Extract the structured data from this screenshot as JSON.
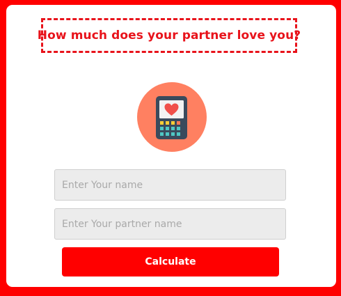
{
  "title": "How much does your partner love you?",
  "logo": {
    "icon": "calculator-heart-icon",
    "circle_color": "#ff8061",
    "body_color": "#3a4a5c",
    "heart_color": "#f0504a"
  },
  "form": {
    "name_placeholder": "Enter Your name",
    "name_value": "",
    "partner_placeholder": "Enter Your partner name",
    "partner_value": "",
    "button_label": "Calculate"
  },
  "colors": {
    "accent": "#ff0000",
    "title": "#e8131b",
    "input_bg": "#ececec"
  }
}
